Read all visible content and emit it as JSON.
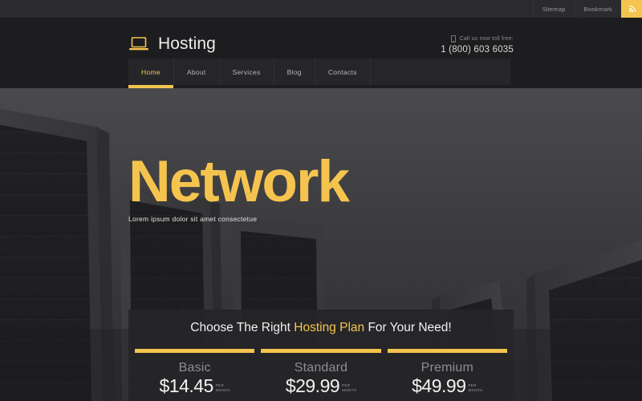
{
  "topbar": {
    "links": [
      {
        "label": "Sitemap"
      },
      {
        "label": "Bookmark"
      }
    ],
    "button_icon": "rss-icon"
  },
  "header": {
    "logo_icon": "laptop-icon",
    "logo_text": "Hosting",
    "contact_icon": "phone-icon",
    "contact_caption": "Call us now toll free:",
    "contact_number": "1 (800) 603 6035"
  },
  "nav": {
    "items": [
      {
        "label": "Home",
        "active": true
      },
      {
        "label": "About",
        "active": false
      },
      {
        "label": "Services",
        "active": false
      },
      {
        "label": "Blog",
        "active": false
      },
      {
        "label": "Contacts",
        "active": false
      }
    ]
  },
  "hero": {
    "title": "Network",
    "subtitle": "Lorem ipsum dolor sit amet consectetue"
  },
  "pricing": {
    "title_before": "Choose The Right ",
    "title_highlight": "Hosting Plan",
    "title_after": " For Your Need!",
    "per_line1": "PER",
    "per_line2": "MONTH",
    "plans": [
      {
        "name": "Basic",
        "price": "$14.45"
      },
      {
        "name": "Standard",
        "price": "$29.99"
      },
      {
        "name": "Premium",
        "price": "$49.99"
      }
    ]
  },
  "colors": {
    "accent": "#f5c44e",
    "topbar_bg": "#2b2b2e",
    "header_bg": "#1d1d1f",
    "nav_bg": "#262629",
    "panel_bg": "#262629",
    "card_bg": "#252528"
  }
}
